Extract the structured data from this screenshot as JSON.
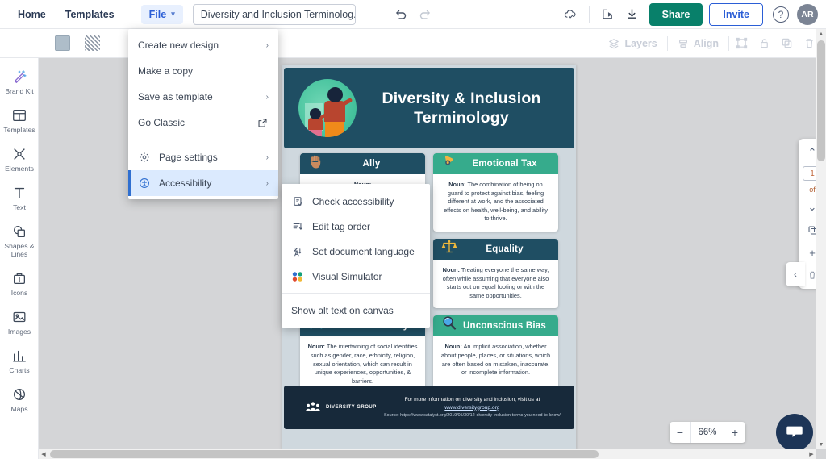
{
  "topbar": {
    "home": "Home",
    "templates": "Templates",
    "file_button": "File",
    "doc_title": "Diversity and Inclusion Terminolog...",
    "undo_icon": "undo-icon",
    "redo_icon": "redo-icon",
    "cloud_icon": "cloud-saved-icon",
    "present_icon": "present-icon",
    "download_icon": "download-icon",
    "share": "Share",
    "invite": "Invite",
    "help": "?",
    "avatar_initials": "AR"
  },
  "subbar": {
    "fill_swatch": "fill-color-swatch",
    "pattern_swatch": "pattern-swatch",
    "layers": "Layers",
    "align": "Align",
    "group_icon": "group-icon",
    "lock_icon": "lock-icon",
    "duplicate_icon": "duplicate-icon",
    "delete_icon": "trash-icon"
  },
  "sidebar": {
    "items": [
      {
        "label": "Brand Kit",
        "icon": "magic-wand-icon"
      },
      {
        "label": "Templates",
        "icon": "templates-icon"
      },
      {
        "label": "Elements",
        "icon": "elements-icon"
      },
      {
        "label": "Text",
        "icon": "text-icon"
      },
      {
        "label": "Shapes & Lines",
        "icon": "shapes-icon"
      },
      {
        "label": "Icons",
        "icon": "icons-icon"
      },
      {
        "label": "Images",
        "icon": "images-icon"
      },
      {
        "label": "Charts",
        "icon": "charts-icon"
      },
      {
        "label": "Maps",
        "icon": "maps-icon"
      }
    ]
  },
  "file_menu": {
    "items": [
      {
        "label": "Create new design",
        "chevron": true,
        "icon": null
      },
      {
        "label": "Make a copy",
        "chevron": false,
        "icon": null
      },
      {
        "label": "Save as template",
        "chevron": true,
        "icon": null
      },
      {
        "label": "Go Classic",
        "chevron": false,
        "icon": "external-link-icon"
      }
    ],
    "page_settings": {
      "label": "Page settings",
      "icon": "gear-icon",
      "chevron": true
    },
    "accessibility": {
      "label": "Accessibility",
      "icon": "accessibility-icon",
      "chevron": true
    }
  },
  "accessibility_submenu": {
    "items": [
      {
        "label": "Check accessibility",
        "icon": "check-accessibility-icon"
      },
      {
        "label": "Edit tag order",
        "icon": "tag-order-icon"
      },
      {
        "label": "Set document language",
        "icon": "language-icon"
      },
      {
        "label": "Visual Simulator",
        "icon": "visual-simulator-icon"
      }
    ],
    "footer_item": "Show alt text on canvas"
  },
  "canvas": {
    "infographic": {
      "title": "Diversity & Inclusion Terminology",
      "illustration": "two-people-illustration",
      "cards": [
        {
          "term": "Ally",
          "icon": "raised-hand-icon",
          "header_color": "#1f4e63",
          "pos": "Noun:",
          "definition": "",
          "partial": true
        },
        {
          "term": "Emotional Tax",
          "icon": "hand-gesture-icon",
          "header_color": "#36ab8c",
          "pos": "Noun:",
          "definition": "The combination of being on guard to protect against bias, feeling different at work, and the associated effects on health, well-being, and ability to thrive."
        },
        {
          "term": "Equality",
          "icon": "scales-icon",
          "header_color": "#1f4e63",
          "pos": "Noun:",
          "definition": "Treating everyone the same way, often while assuming that everyone also starts out on equal footing or with the same opportunities."
        },
        {
          "term": "Intersectionality",
          "icon": "nodes-icon",
          "header_color": "#1f4e63",
          "pos": "Noun:",
          "definition": "The intertwining of social identities such as gender, race, ethnicity, religion, sexual orientation, which can result in unique experiences, opportunities, & barriers."
        },
        {
          "term": "Unconscious Bias",
          "icon": "magnifier-icon",
          "header_color": "#36ab8c",
          "pos": "Noun:",
          "definition": "An implicit association, whether about people, places, or situations, which are often based on mistaken, inaccurate, or incomplete information."
        }
      ],
      "footer": {
        "logo_text": "DIVERSITY GROUP",
        "line1_pre": "For more information on diversity and inclusion, visit us at ",
        "line1_link": "www.diversitygroup.org",
        "line2": "Source: https://www.catalyst.org/2019/05/30/12-diversity-inclusion-terms-you-need-to-know/"
      }
    }
  },
  "page_nav": {
    "up_icon": "chevron-up-icon",
    "page_number": "1",
    "of_label": "of",
    "down_icon": "chevron-down-icon",
    "duplicate_page_icon": "duplicate-page-icon",
    "add_page_icon": "+",
    "delete_page_icon": "trash-page-icon",
    "collapse_icon": "chevron-left-icon"
  },
  "zoom": {
    "minus": "−",
    "value": "66%",
    "plus": "+"
  },
  "chat": {
    "icon": "chat-bubble-icon"
  }
}
